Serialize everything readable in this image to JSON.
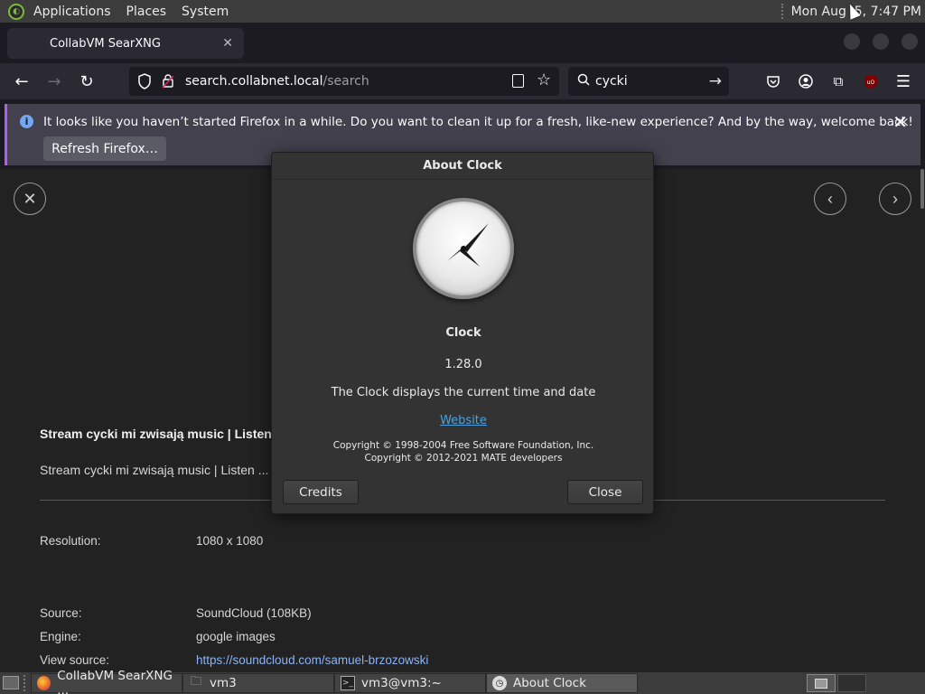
{
  "top_panel": {
    "menus": [
      "Applications",
      "Places",
      "System"
    ],
    "clock": "Mon Aug  5, 7:47 PM"
  },
  "browser": {
    "tab_title": "CollabVM SearXNG",
    "url_domain": "search.collabnet.local",
    "url_path": "/search",
    "search_value": "cycki",
    "notification": {
      "message": "It looks like you haven’t started Firefox in a while. Do you want to clean it up for a fresh, like-new experience? And by the way, welcome back!",
      "button": "Refresh Firefox…"
    }
  },
  "result": {
    "title": "Stream cycki mi zwisają music | Listen to",
    "description": "Stream cycki mi zwisają music | Listen ...",
    "details": [
      {
        "label": "Resolution:",
        "value": "1080 x 1080"
      },
      {
        "label": "Source:",
        "value": "SoundCloud (108KB)"
      },
      {
        "label": "Engine:",
        "value": "google images"
      },
      {
        "label": "View source:",
        "value": "https://soundcloud.com/samuel-brzozowski"
      }
    ]
  },
  "dialog": {
    "title": "About Clock",
    "app_name": "Clock",
    "version": "1.28.0",
    "description": "The Clock displays the current time and date",
    "website": "Website",
    "copyright_1": "Copyright © 1998-2004 Free Software Foundation, Inc.",
    "copyright_2": "Copyright © 2012-2021 MATE developers",
    "credits_button": "Credits",
    "close_button": "Close"
  },
  "taskbar": {
    "items": [
      {
        "label": "CollabVM SearXNG ...",
        "icon": "firefox-icon"
      },
      {
        "label": "vm3",
        "icon": "folder-icon"
      },
      {
        "label": "vm3@vm3:~",
        "icon": "terminal-icon"
      },
      {
        "label": "About Clock",
        "icon": "clock-icon"
      }
    ]
  }
}
